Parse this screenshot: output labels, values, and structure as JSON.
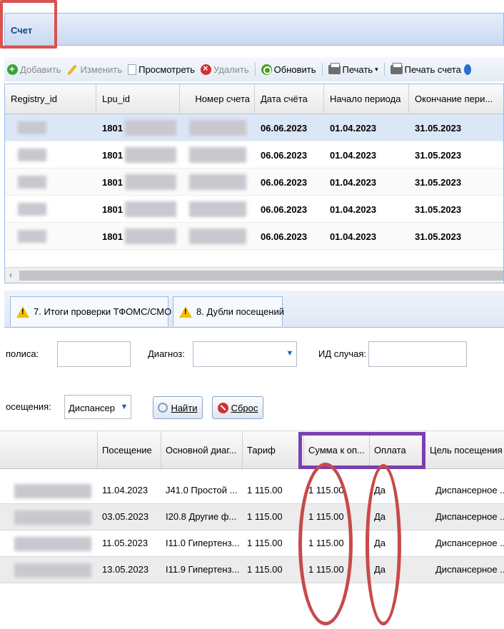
{
  "window": {
    "title": "Счет"
  },
  "toolbar": {
    "add": "Добавить",
    "edit": "Изменить",
    "view": "Просмотреть",
    "delete": "Удалить",
    "refresh": "Обновить",
    "print": "Печать",
    "print_invoice": "Печать счета"
  },
  "invoices": {
    "columns": [
      "Registry_id",
      "Lpu_id",
      "Номер счета",
      "Дата счёта",
      "Начало периода",
      "Окончание пери..."
    ],
    "rows": [
      {
        "lpu": "1801",
        "date": "06.06.2023",
        "start": "01.04.2023",
        "end": "31.05.2023"
      },
      {
        "lpu": "1801",
        "date": "06.06.2023",
        "start": "01.04.2023",
        "end": "31.05.2023"
      },
      {
        "lpu": "1801",
        "date": "06.06.2023",
        "start": "01.04.2023",
        "end": "31.05.2023"
      },
      {
        "lpu": "1801",
        "date": "06.06.2023",
        "start": "01.04.2023",
        "end": "31.05.2023"
      },
      {
        "lpu": "1801",
        "date": "06.06.2023",
        "start": "01.04.2023",
        "end": "31.05.2023"
      }
    ]
  },
  "tabs": [
    {
      "label": "7. Итоги проверки ТФОМС/СМО"
    },
    {
      "label": "8. Дубли посещений"
    }
  ],
  "filters": {
    "policy_label": "полиса:",
    "policy_value": "",
    "diagnosis_label": "Диагноз:",
    "diagnosis_value": "",
    "case_id_label": "ИД случая:",
    "case_id_value": "",
    "visit_type_label": "осещения:",
    "visit_type_value": "Диспансер",
    "find_button": "Найти",
    "reset_button": "Сброс"
  },
  "visits": {
    "columns": [
      "Посещение",
      "Основной диаг...",
      "Тариф",
      "Сумма к оп...",
      "Оплата",
      "Цель посещения"
    ],
    "rows": [
      {
        "date": "11.04.2023",
        "diag": "J41.0 Простой ...",
        "tariff": "1 115.00",
        "sum": "1 115.00",
        "paid": "Да",
        "purpose": "Диспансерное ..."
      },
      {
        "date": "03.05.2023",
        "diag": "I20.8 Другие ф...",
        "tariff": "1 115.00",
        "sum": "1 115.00",
        "paid": "Да",
        "purpose": "Диспансерное ..."
      },
      {
        "date": "11.05.2023",
        "diag": "I11.0 Гипертенз...",
        "tariff": "1 115.00",
        "sum": "1 115.00",
        "paid": "Да",
        "purpose": "Диспансерное ..."
      },
      {
        "date": "13.05.2023",
        "diag": "I11.9 Гипертенз...",
        "tariff": "1 115.00",
        "sum": "1 115.00",
        "paid": "Да",
        "purpose": "Диспансерное ..."
      }
    ]
  },
  "annotation_colors": {
    "red": "#c74a4a",
    "purple": "#7b3fb0"
  }
}
